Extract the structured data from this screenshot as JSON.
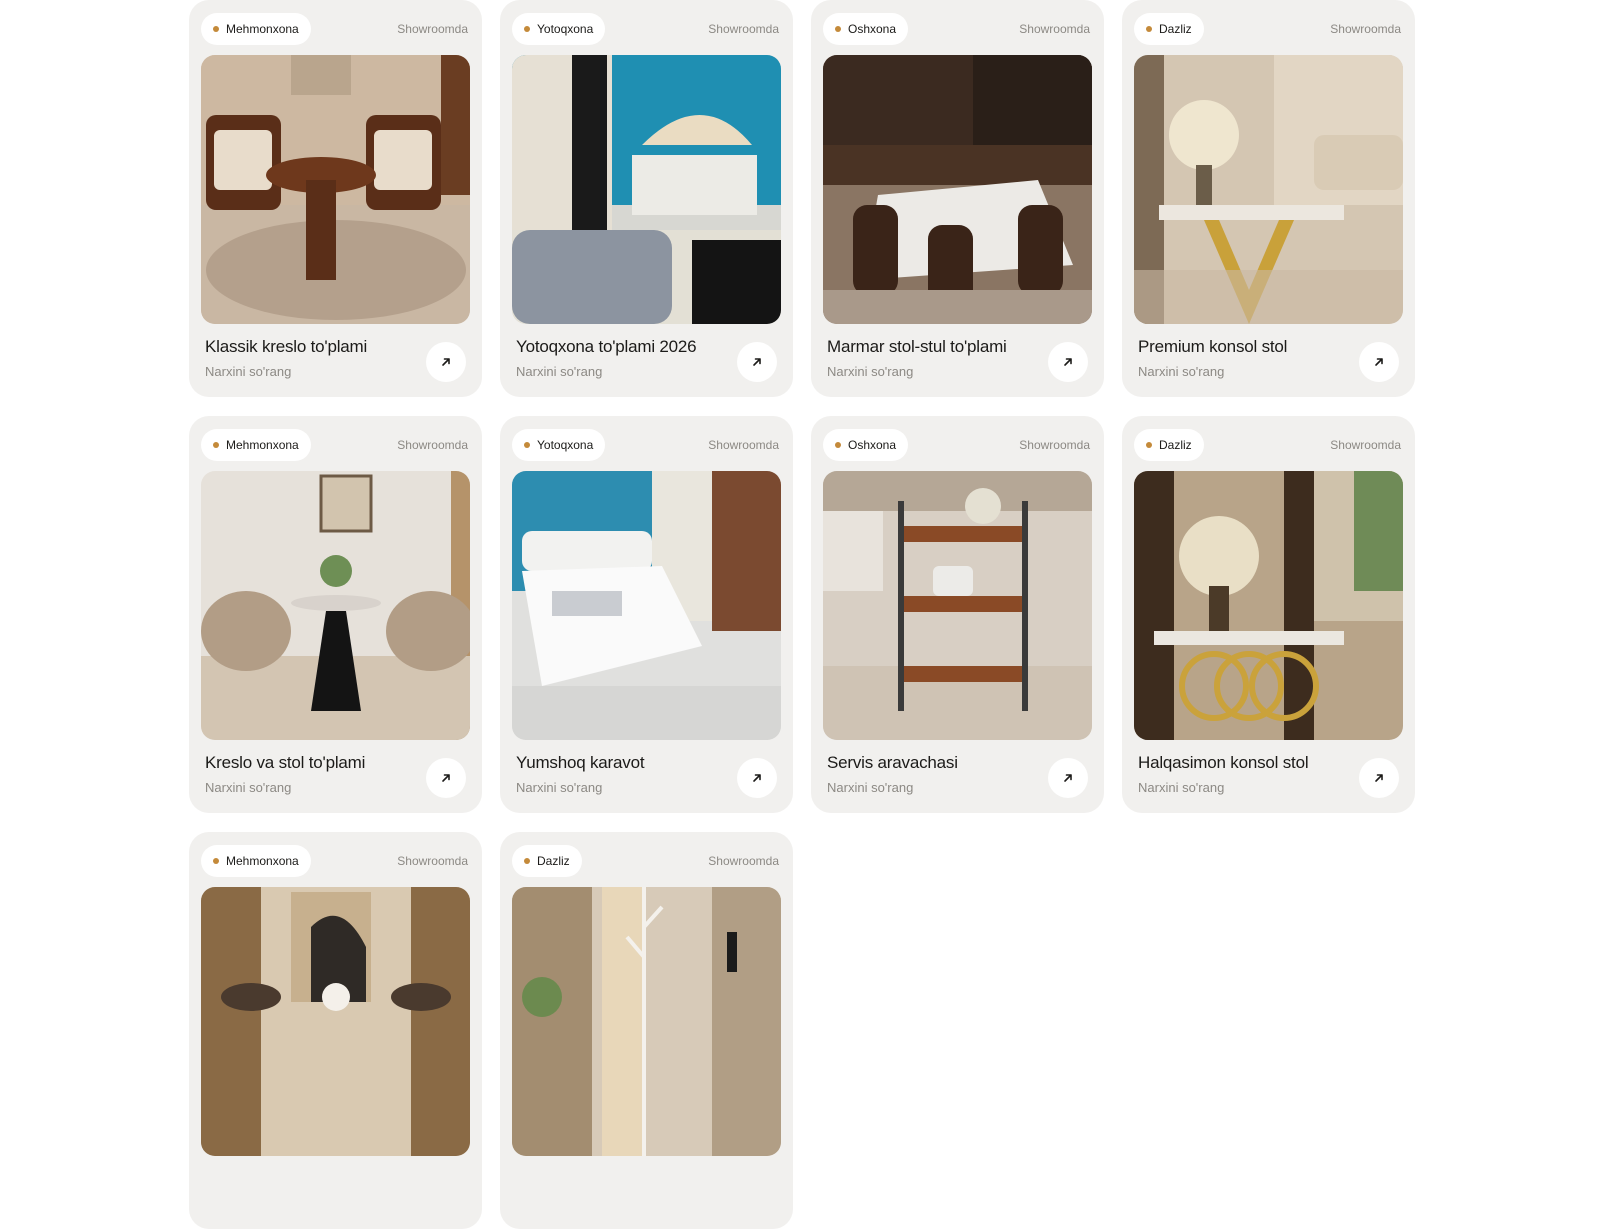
{
  "products": [
    {
      "category": "Mehmonxona",
      "location": "Showroomda",
      "title": "Klassik kreslo to'plami",
      "price": "Narxini so'rang"
    },
    {
      "category": "Yotoqxona",
      "location": "Showroomda",
      "title": "Yotoqxona to'plami 2026",
      "price": "Narxini so'rang"
    },
    {
      "category": "Oshxona",
      "location": "Showroomda",
      "title": "Marmar stol-stul to'plami",
      "price": "Narxini so'rang"
    },
    {
      "category": "Dazliz",
      "location": "Showroomda",
      "title": "Premium konsol stol",
      "price": "Narxini so'rang"
    },
    {
      "category": "Mehmonxona",
      "location": "Showroomda",
      "title": "Kreslo va stol to'plami",
      "price": "Narxini so'rang"
    },
    {
      "category": "Yotoqxona",
      "location": "Showroomda",
      "title": "Yumshoq karavot",
      "price": "Narxini so'rang"
    },
    {
      "category": "Oshxona",
      "location": "Showroomda",
      "title": "Servis aravachasi",
      "price": "Narxini so'rang"
    },
    {
      "category": "Dazliz",
      "location": "Showroomda",
      "title": "Halqasimon konsol stol",
      "price": "Narxini so'rang"
    },
    {
      "category": "Mehmonxona",
      "location": "Showroomda",
      "title": "",
      "price": ""
    },
    {
      "category": "Dazliz",
      "location": "Showroomda",
      "title": "",
      "price": ""
    }
  ],
  "colors": {
    "card_bg": "#f1f0ee",
    "accent_dot": "#c48a3a",
    "muted_text": "#8c8984"
  },
  "icons": {
    "open": "arrow-up-right-icon"
  }
}
